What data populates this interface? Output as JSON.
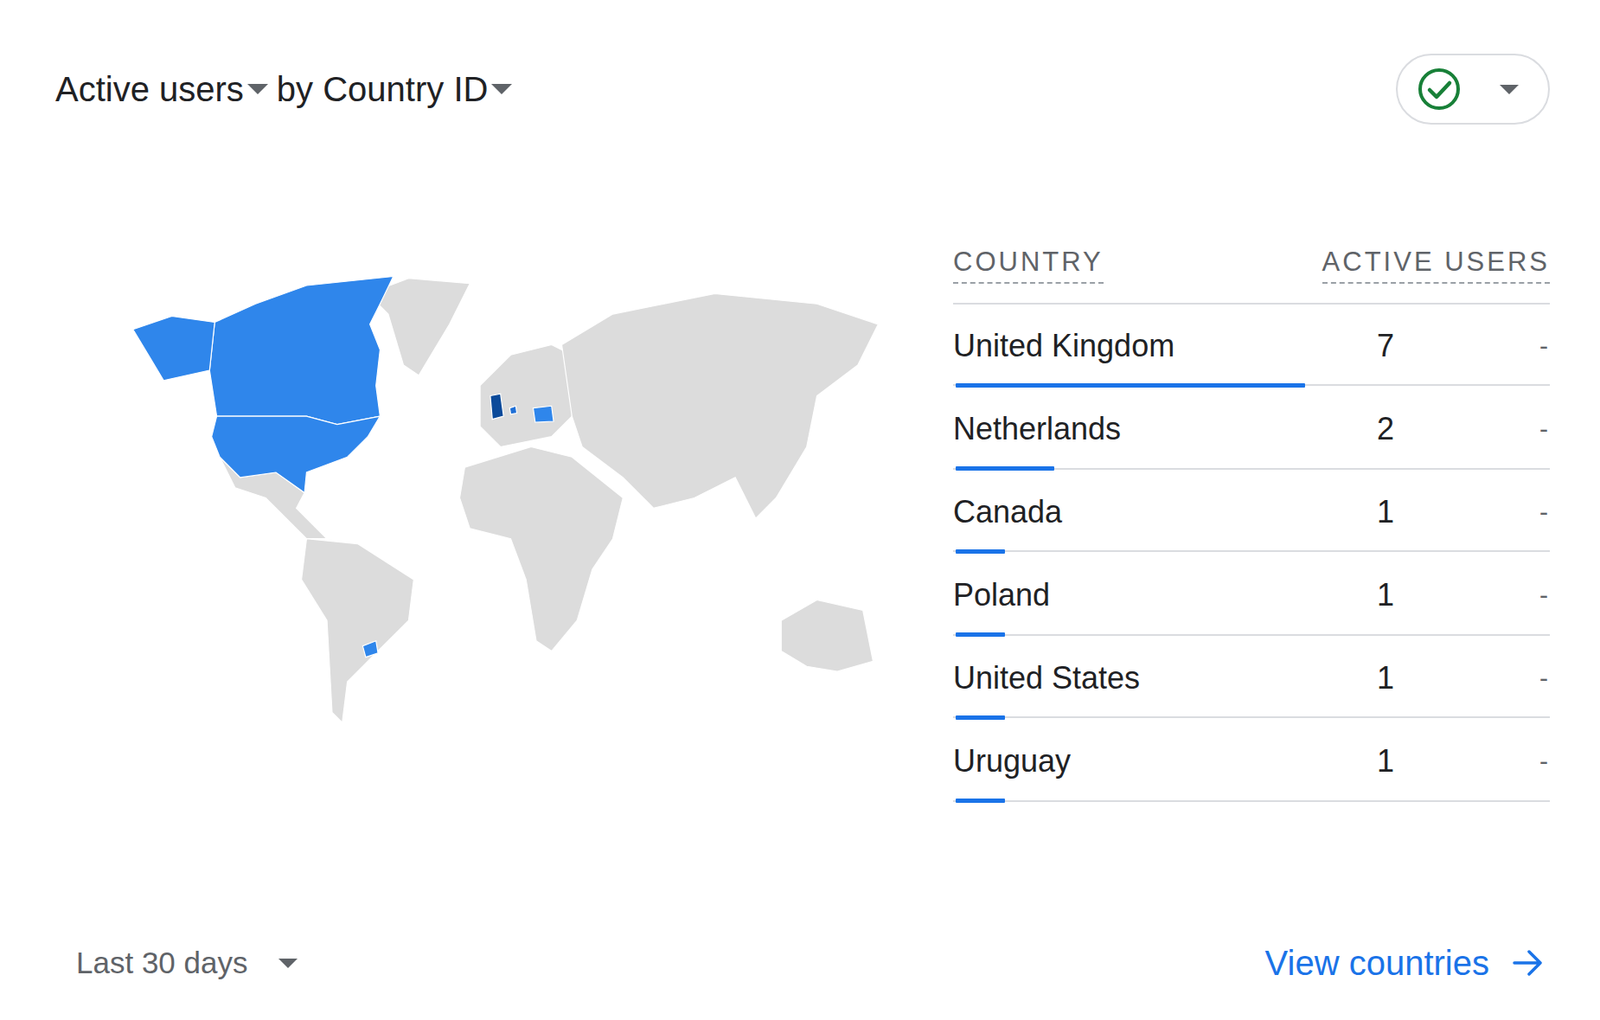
{
  "header": {
    "metric": "Active users",
    "dimension": "by Country ID"
  },
  "table": {
    "columns": [
      "COUNTRY",
      "ACTIVE USERS"
    ],
    "rows": [
      {
        "country": "United Kingdom",
        "active_users": "7",
        "change": "-",
        "level": 0.585,
        "map_color": "#0b4a9a"
      },
      {
        "country": "Netherlands",
        "active_users": "2",
        "change": "-",
        "level": 0.165,
        "map_color": "#1f6fd6"
      },
      {
        "country": "Canada",
        "active_users": "1",
        "change": "-",
        "level": 0.083,
        "map_color": "#2f86eb"
      },
      {
        "country": "Poland",
        "active_users": "1",
        "change": "-",
        "level": 0.083,
        "map_color": "#2f86eb"
      },
      {
        "country": "United States",
        "active_users": "1",
        "change": "-",
        "level": 0.083,
        "map_color": "#2f86eb"
      },
      {
        "country": "Uruguay",
        "active_users": "1",
        "change": "-",
        "level": 0.083,
        "map_color": "#2f86eb"
      }
    ]
  },
  "footer": {
    "date_range": "Last 30 days",
    "link": "View countries"
  }
}
